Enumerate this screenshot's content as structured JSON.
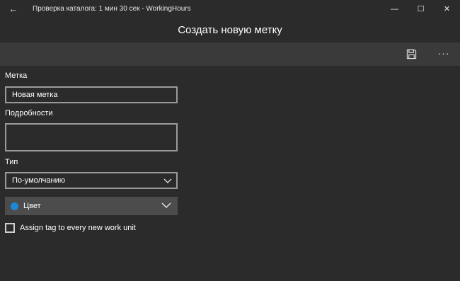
{
  "window": {
    "title": "Проверка каталога: 1 мин 30 сек - WorkingHours",
    "back_icon": "←",
    "minimize_icon": "—",
    "maximize_icon": "☐",
    "close_icon": "✕"
  },
  "page": {
    "title": "Создать новую метку"
  },
  "commandbar": {
    "save_icon": "save-icon",
    "more_label": "···"
  },
  "form": {
    "tag_label": "Метка",
    "tag_value": "Новая метка",
    "details_label": "Подробности",
    "details_value": "",
    "type_label": "Тип",
    "type_value": "По-умолчанию",
    "color_label": "Цвет",
    "color_value": "#1e88d8",
    "assign_label": "Assign tag to every new work unit",
    "assign_checked": false
  }
}
